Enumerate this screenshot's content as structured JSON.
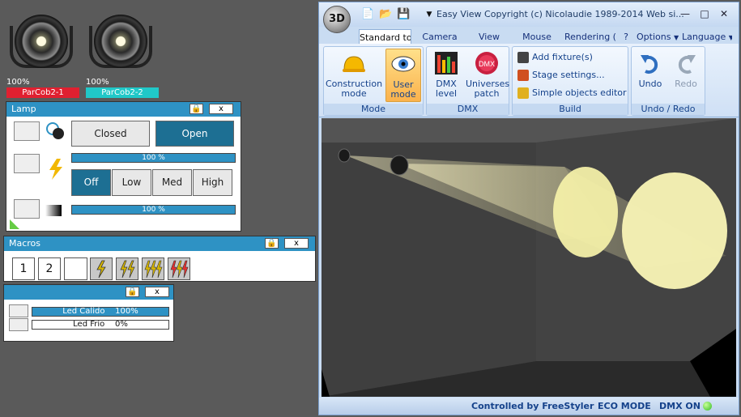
{
  "fixtures": [
    {
      "label": "ParCob2-1",
      "percent": "100%",
      "color": "#e02030"
    },
    {
      "label": "ParCob2-2",
      "percent": "100%",
      "color": "#20c8c8"
    }
  ],
  "lamp_panel": {
    "title": "Lamp",
    "close_label": "x",
    "closed_label": "Closed",
    "open_label": "Open",
    "bar1_text": "100 %",
    "bar1_value": 1.0,
    "levels": [
      "Off",
      "Low",
      "Med",
      "High"
    ],
    "bar2_text": "100 %",
    "bar2_value": 1.0
  },
  "macros_panel": {
    "title": "Macros",
    "close_label": "x",
    "buttons": [
      "1",
      "2",
      ""
    ]
  },
  "led_panel": {
    "close_label": "x",
    "rows": [
      {
        "label": "Led Calido",
        "percent": "100%",
        "value": 1.0
      },
      {
        "label": "Led Frio",
        "percent": "0%",
        "value": 0.0
      }
    ]
  },
  "window": {
    "orb": "3D",
    "title": "Easy View   Copyright (c) Nicolaudie 1989-2014   Web si...",
    "tabs": [
      "Standard to",
      "Camera",
      "View",
      "Mouse",
      "Rendering (",
      "?",
      "Options",
      "Language"
    ],
    "ribbon": {
      "mode_group": "Mode",
      "construction": "Construction mode",
      "user": "User mode",
      "dmx_group": "DMX",
      "dmx_level": "DMX level",
      "universes": "Universes patch",
      "build_group": "Build",
      "add_fixture": "Add fixture(s)",
      "stage_settings": "Stage settings...",
      "simple_objects": "Simple objects editor",
      "undo_group": "Undo / Redo",
      "undo": "Undo",
      "redo": "Redo"
    },
    "status": {
      "controlled": "Controlled by FreeStyler",
      "eco": "ECO MODE",
      "dmx": "DMX ON"
    }
  },
  "colors": {
    "accent": "#2e92c4",
    "active": "#1d6f93"
  }
}
